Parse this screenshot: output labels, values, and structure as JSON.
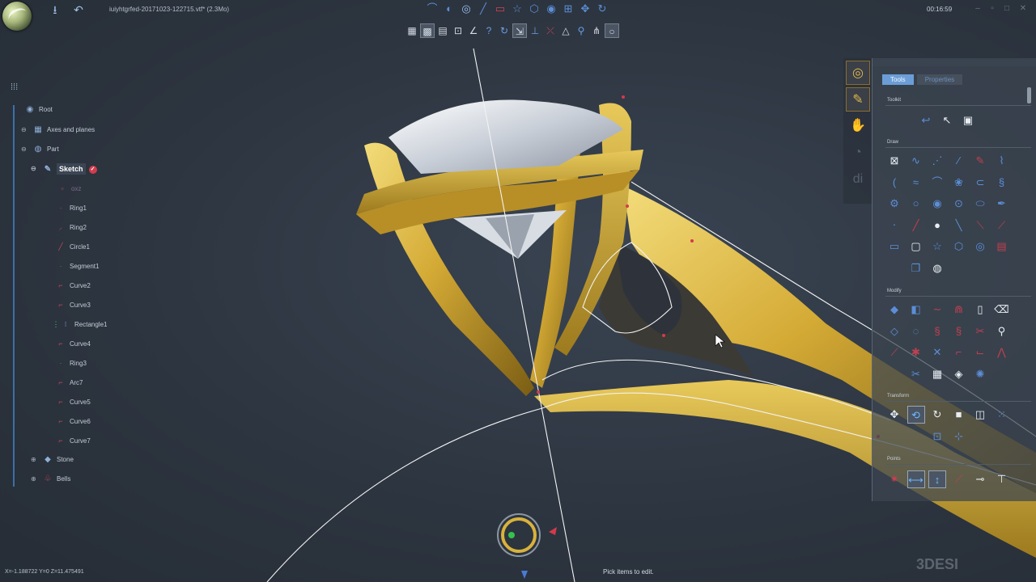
{
  "topbar": {
    "file_title": "iuiyhtgrfed-20171023-122715.vtf* (2.3Mo)",
    "clock": "00:16:59",
    "icons": [
      "save-icon",
      "undo-icon"
    ],
    "window_buttons": [
      "minimize-icon",
      "restore-icon",
      "maximize-icon",
      "close-icon"
    ],
    "top_tools": [
      "curve-tool-icon",
      "mirror-tool-icon",
      "circle-tool-icon",
      "line-tool-icon",
      "rectangle-tool-icon",
      "star-tool-icon",
      "hexagon-tool-icon",
      "spiral-tool-icon",
      "grid-tool-icon",
      "move-tool-icon",
      "rotate-tool-icon"
    ],
    "view_tools": [
      "grid-view-icon",
      "grid-snap-icon",
      "table-icon",
      "snap-icon",
      "angle-icon",
      "help-icon",
      "redo-icon",
      "select-icon",
      "axes-icon",
      "trim-icon",
      "triangle-icon",
      "pin-icon",
      "split-icon",
      "point-icon"
    ]
  },
  "tree": {
    "items": [
      {
        "label": "Root"
      },
      {
        "label": "Axes and planes"
      },
      {
        "label": "Part"
      },
      {
        "label": "Sketch"
      },
      {
        "label": "oxz"
      },
      {
        "label": "Ring1"
      },
      {
        "label": "Ring2"
      },
      {
        "label": "Circle1"
      },
      {
        "label": "Segment1"
      },
      {
        "label": "Curve2"
      },
      {
        "label": "Curve3"
      },
      {
        "label": "Rectangle1"
      },
      {
        "label": "Curve4"
      },
      {
        "label": "Ring3"
      },
      {
        "label": "Arc7"
      },
      {
        "label": "Curve5"
      },
      {
        "label": "Curve6"
      },
      {
        "label": "Curve7"
      },
      {
        "label": "Stone"
      },
      {
        "label": "Bells"
      }
    ]
  },
  "panel": {
    "tabs": [
      "Tools",
      "Properties"
    ],
    "sections": {
      "toolkit": "Toolkit",
      "draw": "Draw",
      "modify": "Modify",
      "transform": "Transform",
      "points": "Points"
    }
  },
  "status": {
    "coords": "X=-1.188722  Y=0  Z=11.475491",
    "message": "Pick items to edit.",
    "watermark": "3DESI"
  },
  "colors": {
    "background": "#2d3540",
    "gold": "#d9b23f",
    "accent_blue": "#5c8ed8",
    "accent_red": "#c2404f",
    "selection_tab": "#6b9ed6"
  }
}
